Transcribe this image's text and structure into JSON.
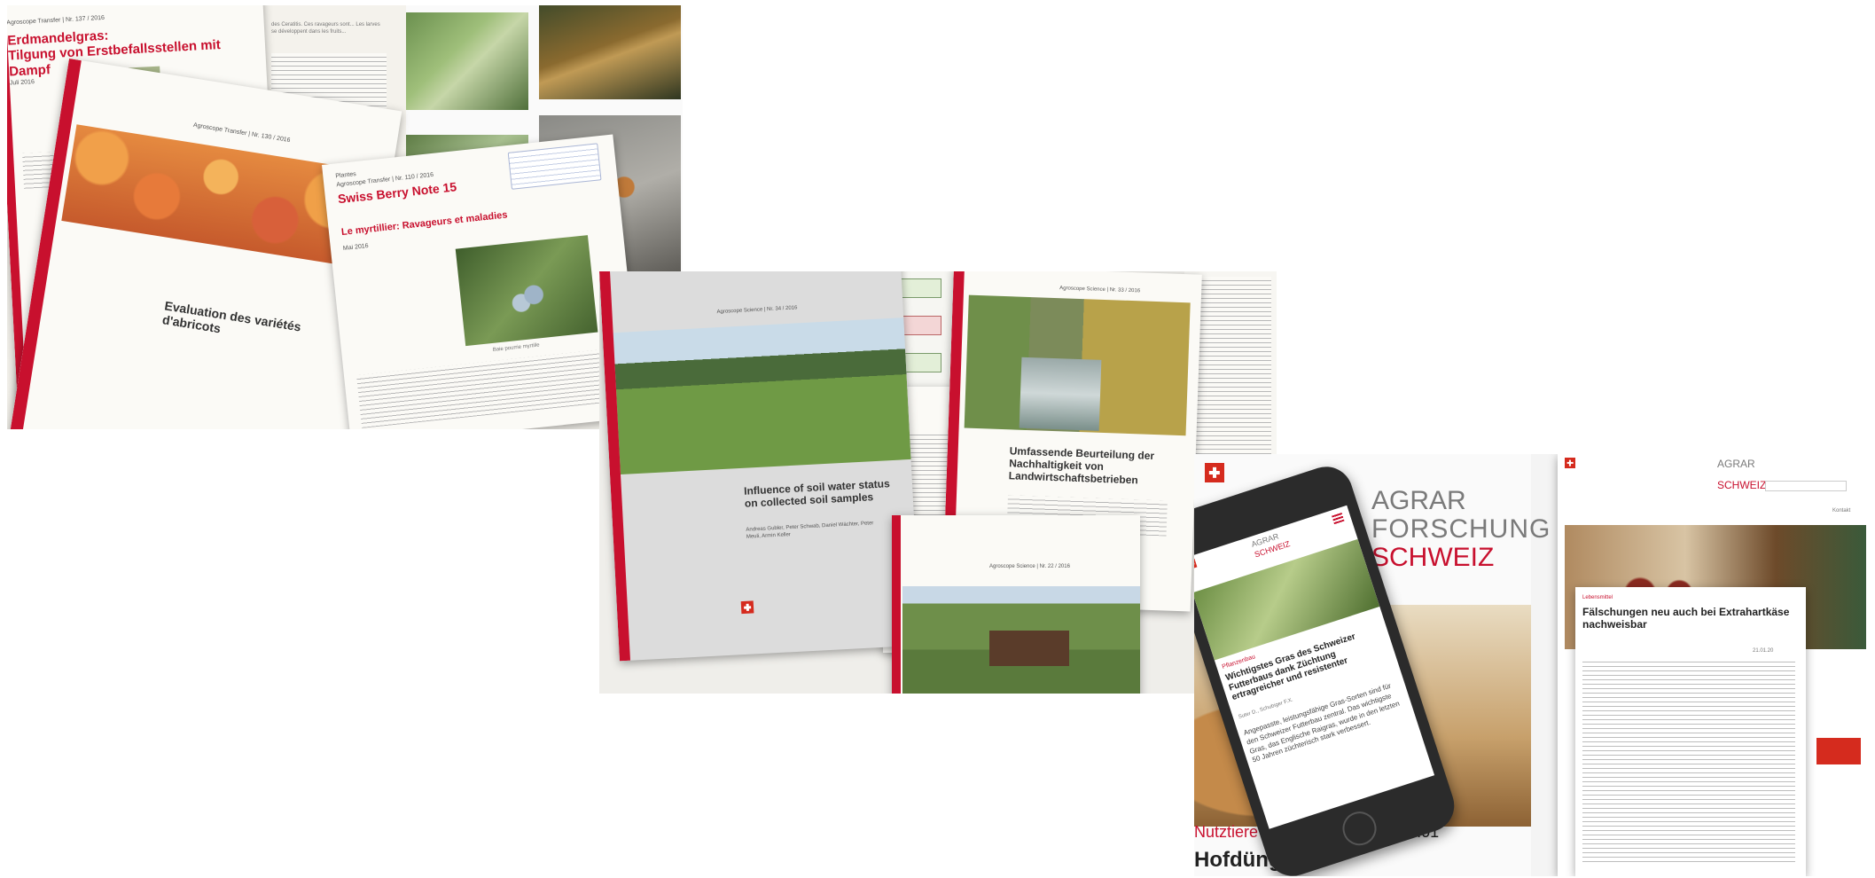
{
  "cluster1": {
    "doc1": {
      "header": "Agroscope Transfer | Nr. 137 / 2016",
      "title_line1": "Erdmandelgras:",
      "title_line2": "Tilgung von Erstbefallsstellen mit Dampf",
      "date": "Juli 2016"
    },
    "doc2": {
      "header": "Agroscope Transfer | Nr. 130 / 2016",
      "title": "Evaluation des variétés d'abricots"
    },
    "doc3": {
      "header": "Agroscope Transfer | Nr. 110 / 2016",
      "kicker": "Plantes",
      "title": "Swiss Berry Note 15",
      "subtitle": "Le myrtillier: Ravageurs et maladies",
      "date": "Mai 2016",
      "caption": "Baie pourrie myrtille"
    },
    "doc4": {
      "text": "des Ceratitis. Ces ravageurs sont... Les larves se développent dans les fruits..."
    }
  },
  "cluster2": {
    "doc1": {
      "header": "Agroscope Science | Nr. 34 / 2016",
      "title": "Influence of soil water status on collected soil samples",
      "authors": "Andreas Gubler, Peter Schwab, Daniel Wächter, Peter Meuli, Armin Keller"
    },
    "doc2": {
      "title": "Umfassende Beurteilung der Nachhaltigkeit von Landwirtschaftsbetrieben",
      "header": "Agroscope Science | Nr. 33 / 2016"
    },
    "doc3": {
      "header": "Agroscope Science | Nr. 22 / 2016"
    }
  },
  "cluster3": {
    "banner": {
      "word1": "AGRAR",
      "word2": "FORSCHUNG",
      "word3": "SCHWEIZ",
      "bottom": "Nutztiere | Schlegel P., W...",
      "bottom2": "| 21.01",
      "headline": "Hofdünger"
    },
    "phone": {
      "category": "Pflanzenbau",
      "headline": "Wichtigstes Gras des Schweizer Futterbaus dank Züchtung ertragreicher und resistenter",
      "authors": "Suter D., Schubiger F.X.",
      "teaser": "Angepasste, leistungsfähige Gras-Sorten sind für den Schweizer Futterbau zentral. Das wichtigste Gras, das Englische Raigras, wurde in den letzten 50 Jahren züchterisch stark verbessert."
    },
    "desktop": {
      "category": "Lebensmittel",
      "headline": "Fälschungen neu auch bei Extrahartkäse nachweisbar",
      "date": "21.01.20",
      "nav": "Kontakt"
    }
  }
}
